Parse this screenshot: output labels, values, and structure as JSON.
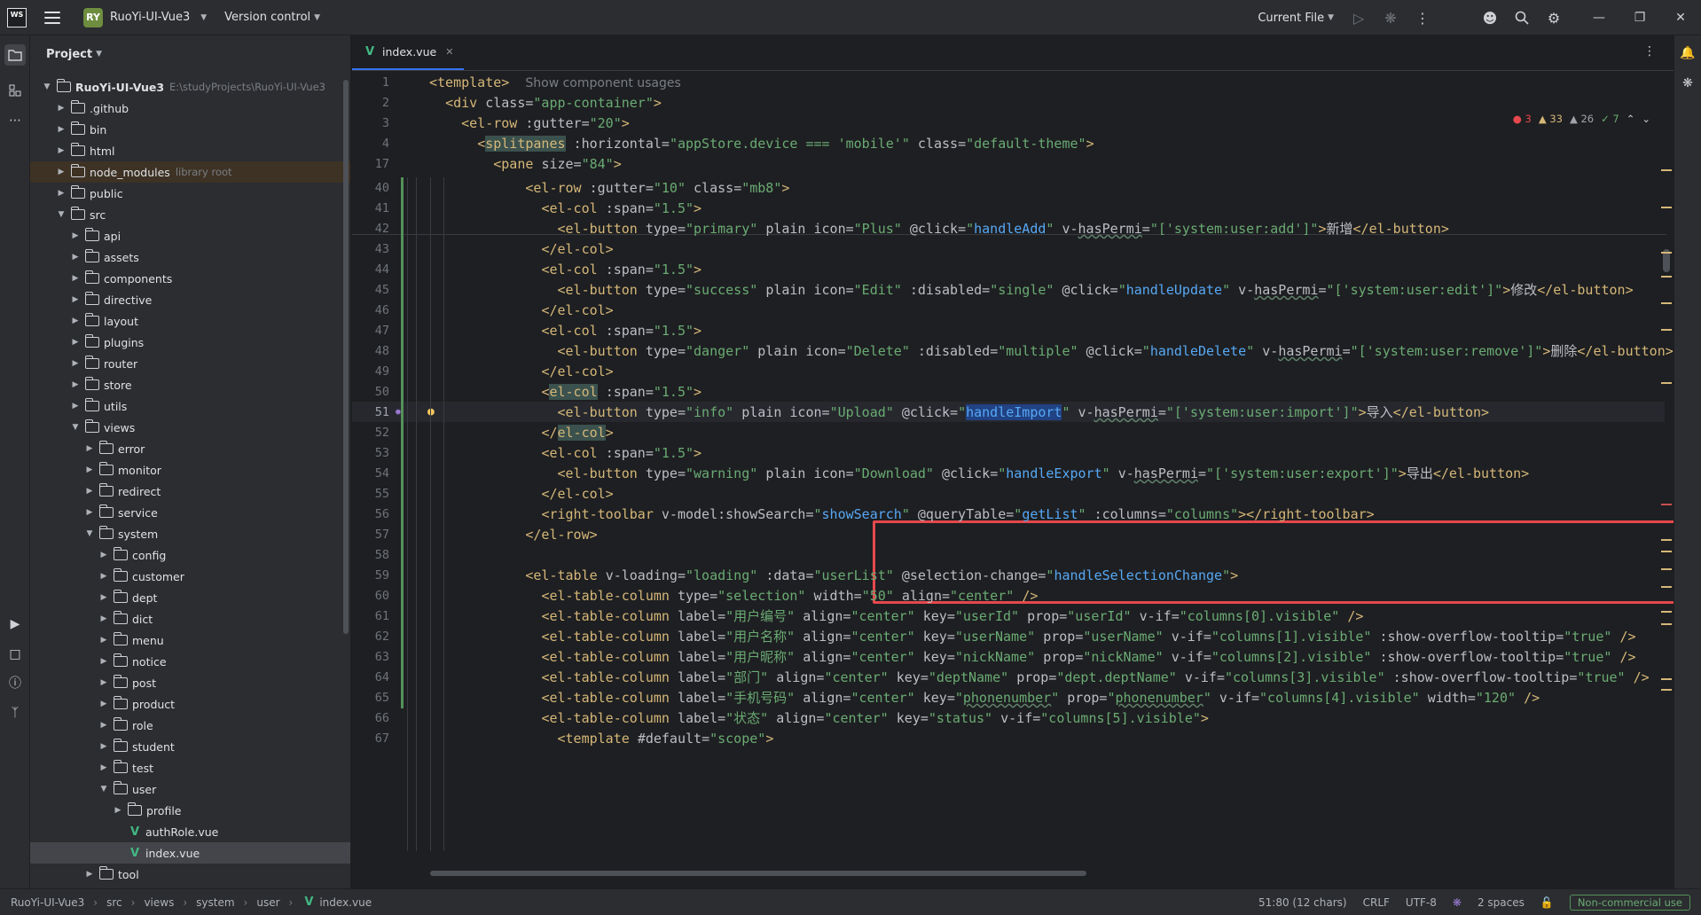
{
  "titlebar": {
    "app_logo": "WS",
    "project_badge": "RY",
    "project_name": "RuoYi-UI-Vue3",
    "version_control": "Version control",
    "run_config": "Current File",
    "icons": [
      "run-icon",
      "debug-icon",
      "more-icon",
      "add-user-icon",
      "search-icon",
      "settings-icon"
    ]
  },
  "project_panel": {
    "title": "Project",
    "tree": [
      {
        "label": "RuoYi-UI-Vue3",
        "hint": "E:\\studyProjects\\RuoYi-UI-Vue3",
        "type": "folder",
        "expanded": true,
        "bold": true
      },
      {
        "label": ".github",
        "type": "folder"
      },
      {
        "label": "bin",
        "type": "folder"
      },
      {
        "label": "html",
        "type": "folder"
      },
      {
        "label": "node_modules",
        "hint": "library root",
        "type": "folder"
      },
      {
        "label": "public",
        "type": "folder"
      },
      {
        "label": "src",
        "type": "folder",
        "expanded": true
      },
      {
        "label": "api",
        "type": "folder"
      },
      {
        "label": "assets",
        "type": "folder"
      },
      {
        "label": "components",
        "type": "folder"
      },
      {
        "label": "directive",
        "type": "folder"
      },
      {
        "label": "layout",
        "type": "folder"
      },
      {
        "label": "plugins",
        "type": "folder"
      },
      {
        "label": "router",
        "type": "folder"
      },
      {
        "label": "store",
        "type": "folder"
      },
      {
        "label": "utils",
        "type": "folder"
      },
      {
        "label": "views",
        "type": "folder",
        "expanded": true
      },
      {
        "label": "error",
        "type": "folder"
      },
      {
        "label": "monitor",
        "type": "folder"
      },
      {
        "label": "redirect",
        "type": "folder"
      },
      {
        "label": "service",
        "type": "folder"
      },
      {
        "label": "system",
        "type": "folder",
        "expanded": true
      },
      {
        "label": "config",
        "type": "folder"
      },
      {
        "label": "customer",
        "type": "folder"
      },
      {
        "label": "dept",
        "type": "folder"
      },
      {
        "label": "dict",
        "type": "folder"
      },
      {
        "label": "menu",
        "type": "folder"
      },
      {
        "label": "notice",
        "type": "folder"
      },
      {
        "label": "post",
        "type": "folder"
      },
      {
        "label": "product",
        "type": "folder"
      },
      {
        "label": "role",
        "type": "folder"
      },
      {
        "label": "student",
        "type": "folder"
      },
      {
        "label": "test",
        "type": "folder"
      },
      {
        "label": "user",
        "type": "folder",
        "expanded": true
      },
      {
        "label": "profile",
        "type": "folder"
      },
      {
        "label": "authRole.vue",
        "type": "vue"
      },
      {
        "label": "index.vue",
        "type": "vue",
        "selected": true
      },
      {
        "label": "tool",
        "type": "folder"
      }
    ]
  },
  "editor": {
    "tab": "index.vue",
    "inspections": {
      "errors": "3",
      "warnings": "33",
      "weak": "26",
      "ok": "7"
    },
    "usage_hint": "Show component usages",
    "lines": [
      {
        "n": "1",
        "html": "<span class=\"t\">&lt;template&gt;</span>  <span class=\"g\">Show component usages</span>"
      },
      {
        "n": "2",
        "html": "  <span class=\"t\">&lt;div</span> <span class=\"a\">class</span>=<span class=\"s\">\"app-container\"</span><span class=\"t\">&gt;</span>"
      },
      {
        "n": "3",
        "html": "    <span class=\"t\">&lt;el-row</span> <span class=\"a\">:gutter</span>=<span class=\"s\">\"20\"</span><span class=\"t\">&gt;</span>"
      },
      {
        "n": "4",
        "html": "      <span class=\"t\">&lt;<span class=\"match\">splitpanes</span></span> <span class=\"a\">:horizontal</span>=<span class=\"s\">\"appStore.device === 'mobile'\"</span> <span class=\"a\">class</span>=<span class=\"s\">\"default-theme\"</span><span class=\"t\">&gt;</span>"
      },
      {
        "n": "17",
        "html": "        <span class=\"t\">&lt;pane</span> <span class=\"a\">size</span>=<span class=\"s\">\"84\"</span><span class=\"t\">&gt;</span>"
      },
      {
        "n": "40",
        "html": "            <span class=\"t\">&lt;el-row</span> <span class=\"a\">:gutter</span>=<span class=\"s\">\"10\"</span> <span class=\"a\">class</span>=<span class=\"s\">\"mb8\"</span><span class=\"t\">&gt;</span>"
      },
      {
        "n": "41",
        "html": "              <span class=\"t\">&lt;el-col</span> <span class=\"a\">:span</span>=<span class=\"s\">\"1.5\"</span><span class=\"t\">&gt;</span>"
      },
      {
        "n": "42",
        "html": "                <span class=\"t\">&lt;el-button</span> <span class=\"a\">type</span>=<span class=\"s\">\"primary\"</span> <span class=\"a\">plain</span> <span class=\"a\">icon</span>=<span class=\"s\">\"Plus\"</span> <span class=\"a\">@click</span>=<span class=\"s\">\"<span class=\"v\">handleAdd</span>\"</span> <span class=\"a\">v-<span class=\"u\">hasPermi</span></span>=<span class=\"s\">\"[<span class=\"s\">'system:user:add'</span>]\"</span><span class=\"t\">&gt;</span>新增<span class=\"t\">&lt;/el-button&gt;</span>"
      },
      {
        "n": "43",
        "html": "              <span class=\"t\">&lt;/el-col&gt;</span>"
      },
      {
        "n": "44",
        "html": "              <span class=\"t\">&lt;el-col</span> <span class=\"a\">:span</span>=<span class=\"s\">\"1.5\"</span><span class=\"t\">&gt;</span>"
      },
      {
        "n": "45",
        "html": "                <span class=\"t\">&lt;el-button</span> <span class=\"a\">type</span>=<span class=\"s\">\"success\"</span> <span class=\"a\">plain</span> <span class=\"a\">icon</span>=<span class=\"s\">\"Edit\"</span> <span class=\"a\">:disabled</span>=<span class=\"s\">\"single\"</span> <span class=\"a\">@click</span>=<span class=\"s\">\"<span class=\"v\">handleUpdate</span>\"</span> <span class=\"a\">v-<span class=\"u\">hasPermi</span></span>=<span class=\"s\">\"['system:user:edit']\"</span><span class=\"t\">&gt;</span>修改<span class=\"t\">&lt;/el-button&gt;</span>"
      },
      {
        "n": "46",
        "html": "              <span class=\"t\">&lt;/el-col&gt;</span>"
      },
      {
        "n": "47",
        "html": "              <span class=\"t\">&lt;el-col</span> <span class=\"a\">:span</span>=<span class=\"s\">\"1.5\"</span><span class=\"t\">&gt;</span>"
      },
      {
        "n": "48",
        "html": "                <span class=\"t\">&lt;el-button</span> <span class=\"a\">type</span>=<span class=\"s\">\"danger\"</span> <span class=\"a\">plain</span> <span class=\"a\">icon</span>=<span class=\"s\">\"Delete\"</span> <span class=\"a\">:disabled</span>=<span class=\"s\">\"multiple\"</span> <span class=\"a\">@click</span>=<span class=\"s\">\"<span class=\"v\">handleDelete</span>\"</span> <span class=\"a\">v-<span class=\"u\">hasPermi</span></span>=<span class=\"s\">\"['system:user:remove']\"</span><span class=\"t\">&gt;</span>删除<span class=\"t\">&lt;/el-button&gt;</span>"
      },
      {
        "n": "49",
        "html": "              <span class=\"t\">&lt;/el-col&gt;</span>"
      },
      {
        "n": "50",
        "html": "              <span class=\"t\">&lt;<span class=\"match\">el-col</span></span> <span class=\"a\">:span</span>=<span class=\"s\">\"1.5\"</span><span class=\"t\">&gt;</span>"
      },
      {
        "n": "51",
        "html": "                <span class=\"t\">&lt;el-button</span> <span class=\"a\">type</span>=<span class=\"s\">\"info\"</span> <span class=\"a\">plain</span> <span class=\"a\">icon</span>=<span class=\"s\">\"Upload\"</span> <span class=\"a\">@click</span>=<span class=\"s\">\"<span class=\"v sel\">handleImport</span>\"</span> <span class=\"a\">v-<span class=\"u\">hasPermi</span></span>=<span class=\"s\">\"['system:user:import']\"</span><span class=\"t\">&gt;</span>导入<span class=\"t\">&lt;/el-button&gt;</span>",
        "current": true
      },
      {
        "n": "52",
        "html": "              <span class=\"t\">&lt;/<span class=\"match\">el-col</span>&gt;</span>"
      },
      {
        "n": "53",
        "html": "              <span class=\"t\">&lt;el-col</span> <span class=\"a\">:span</span>=<span class=\"s\">\"1.5\"</span><span class=\"t\">&gt;</span>"
      },
      {
        "n": "54",
        "html": "                <span class=\"t\">&lt;el-button</span> <span class=\"a\">type</span>=<span class=\"s\">\"warning\"</span> <span class=\"a\">plain</span> <span class=\"a\">icon</span>=<span class=\"s\">\"Download\"</span> <span class=\"a\">@click</span>=<span class=\"s\">\"<span class=\"v\">handleExport</span>\"</span> <span class=\"a\">v-<span class=\"u\">hasPermi</span></span>=<span class=\"s\">\"['system:user:export']\"</span><span class=\"t\">&gt;</span>导出<span class=\"t\">&lt;/el-button&gt;</span>"
      },
      {
        "n": "55",
        "html": "              <span class=\"t\">&lt;/el-col&gt;</span>"
      },
      {
        "n": "56",
        "html": "              <span class=\"t\">&lt;right-toolbar</span> <span class=\"a\">v-model:showSearch</span>=<span class=\"s\">\"<span class=\"v\">showSearch</span>\"</span> <span class=\"a\">@queryTable</span>=<span class=\"s\">\"<span class=\"v\">getList</span>\"</span> <span class=\"a\">:columns</span>=<span class=\"s\">\"columns\"</span><span class=\"t\">&gt;&lt;/right-toolbar&gt;</span>"
      },
      {
        "n": "57",
        "html": "            <span class=\"t\">&lt;/el-row&gt;</span>"
      },
      {
        "n": "58",
        "html": ""
      },
      {
        "n": "59",
        "html": "            <span class=\"t\">&lt;el-table</span> <span class=\"a\">v-loading</span>=<span class=\"s\">\"loading\"</span> <span class=\"a\">:data</span>=<span class=\"s\">\"userList\"</span> <span class=\"a\">@selection-change</span>=<span class=\"s\">\"<span class=\"v\">handleSelectionChange</span>\"</span><span class=\"t\">&gt;</span>"
      },
      {
        "n": "60",
        "html": "              <span class=\"t\">&lt;el-table-column</span> <span class=\"a\">type</span>=<span class=\"s\">\"selection\"</span> <span class=\"a\">width</span>=<span class=\"s\">\"50\"</span> <span class=\"a\">align</span>=<span class=\"s\">\"center\"</span> <span class=\"t\">/&gt;</span>"
      },
      {
        "n": "61",
        "html": "              <span class=\"t\">&lt;el-table-column</span> <span class=\"a\">label</span>=<span class=\"s\">\"用户编号\"</span> <span class=\"a\">align</span>=<span class=\"s\">\"center\"</span> <span class=\"a\">key</span>=<span class=\"s\">\"userId\"</span> <span class=\"a\">prop</span>=<span class=\"s\">\"userId\"</span> <span class=\"a\">v-if</span>=<span class=\"s\">\"columns[0].visible\"</span> <span class=\"t\">/&gt;</span>"
      },
      {
        "n": "62",
        "html": "              <span class=\"t\">&lt;el-table-column</span> <span class=\"a\">label</span>=<span class=\"s\">\"用户名称\"</span> <span class=\"a\">align</span>=<span class=\"s\">\"center\"</span> <span class=\"a\">key</span>=<span class=\"s\">\"userName\"</span> <span class=\"a\">prop</span>=<span class=\"s\">\"userName\"</span> <span class=\"a\">v-if</span>=<span class=\"s\">\"columns[1].visible\"</span> <span class=\"a\">:show-overflow-tooltip</span>=<span class=\"s\">\"true\"</span> <span class=\"t\">/&gt;</span>"
      },
      {
        "n": "63",
        "html": "              <span class=\"t\">&lt;el-table-column</span> <span class=\"a\">label</span>=<span class=\"s\">\"用户昵称\"</span> <span class=\"a\">align</span>=<span class=\"s\">\"center\"</span> <span class=\"a\">key</span>=<span class=\"s\">\"nickName\"</span> <span class=\"a\">prop</span>=<span class=\"s\">\"nickName\"</span> <span class=\"a\">v-if</span>=<span class=\"s\">\"columns[2].visible\"</span> <span class=\"a\">:show-overflow-tooltip</span>=<span class=\"s\">\"true\"</span> <span class=\"t\">/&gt;</span>"
      },
      {
        "n": "64",
        "html": "              <span class=\"t\">&lt;el-table-column</span> <span class=\"a\">label</span>=<span class=\"s\">\"部门\"</span> <span class=\"a\">align</span>=<span class=\"s\">\"center\"</span> <span class=\"a\">key</span>=<span class=\"s\">\"deptName\"</span> <span class=\"a\">prop</span>=<span class=\"s\">\"dept.deptName\"</span> <span class=\"a\">v-if</span>=<span class=\"s\">\"columns[3].visible\"</span> <span class=\"a\">:show-overflow-tooltip</span>=<span class=\"s\">\"true\"</span> <span class=\"t\">/&gt;</span>"
      },
      {
        "n": "65",
        "html": "              <span class=\"t\">&lt;el-table-column</span> <span class=\"a\">label</span>=<span class=\"s\">\"手机号码\"</span> <span class=\"a\">align</span>=<span class=\"s\">\"center\"</span> <span class=\"a\">key</span>=<span class=\"s\">\"<span class=\"u\">phonenumber</span>\"</span> <span class=\"a\">prop</span>=<span class=\"s\">\"<span class=\"u\">phonenumber</span>\"</span> <span class=\"a\">v-if</span>=<span class=\"s\">\"columns[4].visible\"</span> <span class=\"a\">width</span>=<span class=\"s\">\"120\"</span> <span class=\"t\">/&gt;</span>"
      },
      {
        "n": "66",
        "html": "              <span class=\"t\">&lt;el-table-column</span> <span class=\"a\">label</span>=<span class=\"s\">\"状态\"</span> <span class=\"a\">align</span>=<span class=\"s\">\"center\"</span> <span class=\"a\">key</span>=<span class=\"s\">\"status\"</span> <span class=\"a\">v-if</span>=<span class=\"s\">\"columns[5].visible\"</span><span class=\"t\">&gt;</span>"
      },
      {
        "n": "67",
        "html": "                <span class=\"t\">&lt;template</span> <span class=\"a\">#default</span>=<span class=\"s\">\"scope\"</span><span class=\"t\">&gt;</span>"
      }
    ]
  },
  "statusbar": {
    "breadcrumb": [
      "RuoYi-UI-Vue3",
      "src",
      "views",
      "system",
      "user",
      "index.vue"
    ],
    "position": "51:80 (12 chars)",
    "line_ending": "CRLF",
    "encoding": "UTF-8",
    "indent": "2 spaces",
    "license": "Non-commercial use"
  }
}
